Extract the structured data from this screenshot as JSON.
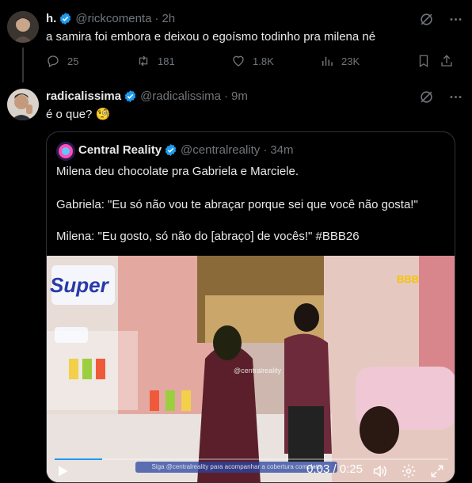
{
  "tweet1": {
    "display_name": "h.",
    "handle": "@rickcomenta",
    "time": "2h",
    "text": "a samira foi embora e deixou o egoísmo todinho pra milena né",
    "replies": "25",
    "retweets": "181",
    "likes": "1.8K",
    "views": "23K"
  },
  "tweet2": {
    "display_name": "radicalissima",
    "handle": "@radicalissima",
    "time": "9m",
    "text": "é o que? 🧐"
  },
  "quote": {
    "display_name": "Central Reality",
    "handle": "@centralreality",
    "time": "34m",
    "line1": "Milena deu chocolate pra Gabriela e Marciele.",
    "line2": "Gabriela: \"Eu só não vou te abraçar porque sei que você não gosta!\"",
    "line3": "Milena: \"Eu gosto, só não do [abraço] de vocês!\" #BBB26",
    "video": {
      "time_readout": "0:03 / 0:25",
      "progress": 0.12,
      "watermark": "@centralreality",
      "logo_text": "BBB",
      "brand_text": "Super",
      "caption": "Siga @centralreality para acompanhar a cobertura completa"
    }
  },
  "colors": {
    "background": "#000000",
    "text": "#e7e9ea",
    "muted": "#71767b",
    "verified": "#1d9bf0",
    "border": "#2f3336"
  }
}
